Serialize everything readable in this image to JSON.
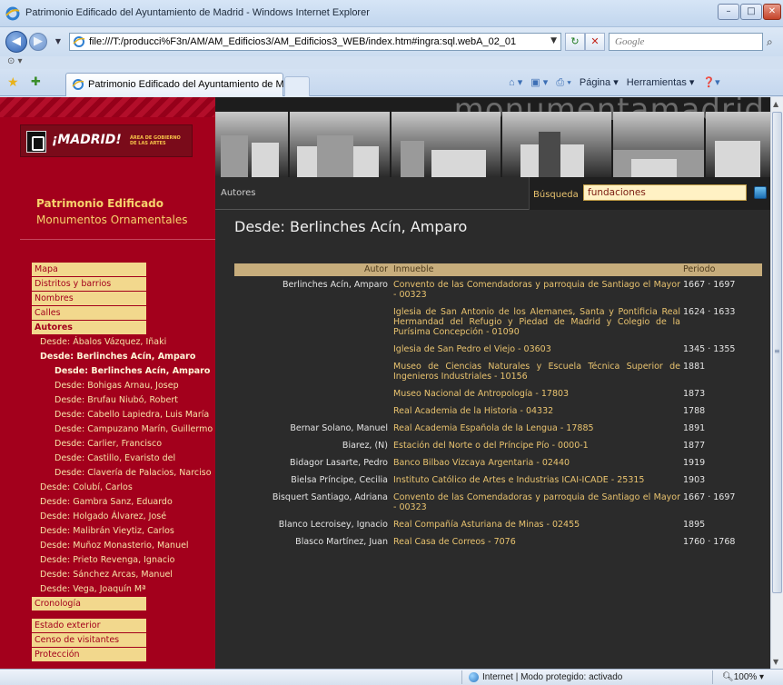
{
  "window": {
    "title": "Patrimonio Edificado del Ayuntamiento de Madrid - Windows Internet Explorer",
    "min_label": "–",
    "max_label": "□",
    "close_label": "✕"
  },
  "address_bar": {
    "url": "file:///T:/producci%F3n/AM/AM_Edificios3/AM_Edificios3_WEB/index.htm#ingra:sql.webA_02_01",
    "search_placeholder": "Google"
  },
  "tabs": [
    {
      "label": "Patrimonio Edificado del Ayuntamiento de Madrid"
    }
  ],
  "command_bar": {
    "page_label": "Página ▾",
    "tools_label": "Herramientas ▾"
  },
  "site": {
    "brand": "monumentamadrid",
    "logo_text": "¡MADRID!",
    "logo_area": "ÁREA DE GOBIERNO DE LAS ARTES",
    "section_title": "Patrimonio Edificado",
    "section_sub": "Monumentos Ornamentales",
    "breadcrumb": "Autores",
    "search_label": "Búsqueda",
    "search_value": "fundaciones",
    "heading": "Desde: Berlinches Acín, Amparo"
  },
  "menu": [
    {
      "label": "Mapa",
      "style": "box"
    },
    {
      "label": "Distritos y barrios",
      "style": "box"
    },
    {
      "label": "Nombres",
      "style": "box"
    },
    {
      "label": "Calles",
      "style": "box"
    },
    {
      "label": "Autores",
      "style": "box bold"
    },
    {
      "label": "Desde: Ábalos Vázquez, Iñaki",
      "style": "l1"
    },
    {
      "label": "Desde: Berlinches Acín, Amparo",
      "style": "l1 bold"
    },
    {
      "label": "Desde: Berlinches Acín, Amparo",
      "style": "l2 bold"
    },
    {
      "label": "Desde: Bohigas Arnau, Josep",
      "style": "l2"
    },
    {
      "label": "Desde: Brufau Niubó, Robert",
      "style": "l2"
    },
    {
      "label": "Desde: Cabello Lapiedra, Luis María",
      "style": "l2"
    },
    {
      "label": "Desde: Campuzano Marín, Guillermo",
      "style": "l2"
    },
    {
      "label": "Desde: Carlier, Francisco",
      "style": "l2"
    },
    {
      "label": "Desde: Castillo, Evaristo del",
      "style": "l2"
    },
    {
      "label": "Desde: Clavería de Palacios, Narciso",
      "style": "l2"
    },
    {
      "label": "Desde: Colubí, Carlos",
      "style": "l1"
    },
    {
      "label": "Desde: Gambra Sanz, Eduardo",
      "style": "l1"
    },
    {
      "label": "Desde: Holgado Álvarez, José",
      "style": "l1"
    },
    {
      "label": "Desde: Malibrán Vieytiz, Carlos",
      "style": "l1"
    },
    {
      "label": "Desde: Muñoz Monasterio, Manuel",
      "style": "l1"
    },
    {
      "label": "Desde: Prieto Revenga, Ignacio",
      "style": "l1"
    },
    {
      "label": "Desde: Sánchez Arcas, Manuel",
      "style": "l1"
    },
    {
      "label": "Desde: Vega, Joaquín Mª",
      "style": "l1"
    },
    {
      "label": "Cronología",
      "style": "box"
    },
    {
      "label": "",
      "style": "gap"
    },
    {
      "label": "Estado exterior",
      "style": "box"
    },
    {
      "label": "Censo de visitantes",
      "style": "box"
    },
    {
      "label": "Protección",
      "style": "box"
    }
  ],
  "table": {
    "headers": {
      "autor": "Autor",
      "inmueble": "Inmueble",
      "periodo": "Periodo"
    },
    "rows": [
      {
        "autor": "Berlinches Acín, Amparo",
        "inmueble": "Convento de las Comendadoras y parroquia de Santiago el Mayor - 00323",
        "periodo": "1667 · 1697",
        "lines": 2
      },
      {
        "autor": "",
        "inmueble": "Iglesia de San Antonio de los Alemanes, Santa y Pontificia Real Hermandad del Refugio y Piedad de Madrid y Colegio de la Purísima Concepción - 01090",
        "periodo": "1624 · 1633",
        "lines": 3
      },
      {
        "autor": "",
        "inmueble": "Iglesia de San Pedro el Viejo - 03603",
        "periodo": "1345 · 1355",
        "lines": 1
      },
      {
        "autor": "",
        "inmueble": "Museo de Ciencias Naturales y Escuela Técnica Superior de Ingenieros Industriales - 10156",
        "periodo": "1881",
        "lines": 2
      },
      {
        "autor": "",
        "inmueble": "Museo Nacional de Antropología - 17803",
        "periodo": "1873",
        "lines": 1
      },
      {
        "autor": "",
        "inmueble": "Real Academia de la Historia - 04332",
        "periodo": "1788",
        "lines": 1
      },
      {
        "autor": "Bernar Solano, Manuel",
        "inmueble": "Real Academia Española de la Lengua - 17885",
        "periodo": "1891",
        "lines": 1
      },
      {
        "autor": "Biarez, (N)",
        "inmueble": "Estación del Norte o del Príncipe Pío - 0000-1",
        "periodo": "1877",
        "lines": 1
      },
      {
        "autor": "Bidagor Lasarte, Pedro",
        "inmueble": "Banco Bilbao Vizcaya Argentaria - 02440",
        "periodo": "1919",
        "lines": 1
      },
      {
        "autor": "Bielsa Príncipe, Cecilia",
        "inmueble": "Instituto Católico de Artes e Industrias ICAI-ICADE - 25315",
        "periodo": "1903",
        "lines": 1
      },
      {
        "autor": "Bisquert Santiago, Adriana",
        "inmueble": "Convento de las Comendadoras y parroquia de Santiago el Mayor - 00323",
        "periodo": "1667 · 1697",
        "lines": 2
      },
      {
        "autor": "Blanco Lecroisey, Ignacio",
        "inmueble": "Real Compañía Asturiana de Minas - 02455",
        "periodo": "1895",
        "lines": 1
      },
      {
        "autor": "Blasco Martínez, Juan",
        "inmueble": "Real Casa de Correos - 7076",
        "periodo": "1760 · 1768",
        "lines": 1
      }
    ]
  },
  "status_bar": {
    "zone": "Internet | Modo protegido: activado",
    "zoom": "100%"
  },
  "colors": {
    "sidebar_red": "#a3001c",
    "menu_box": "#f2d88d",
    "link_gold": "#e9c36f",
    "table_header": "#c7ad7c"
  }
}
